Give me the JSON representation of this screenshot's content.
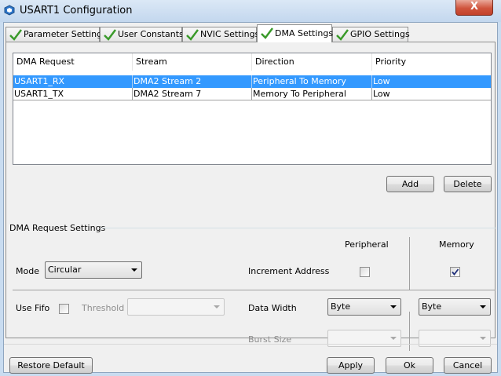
{
  "window": {
    "title": "USART1 Configuration",
    "close_label": "X"
  },
  "tabs": [
    {
      "label": "Parameter Settings",
      "active": false
    },
    {
      "label": "User Constants",
      "active": false
    },
    {
      "label": "NVIC Settings",
      "active": false
    },
    {
      "label": "DMA Settings",
      "active": true
    },
    {
      "label": "GPIO Settings",
      "active": false
    }
  ],
  "dma_table": {
    "columns": [
      "DMA Request",
      "Stream",
      "Direction",
      "Priority"
    ],
    "rows": [
      {
        "request": "USART1_RX",
        "stream": "DMA2 Stream 2",
        "direction": "Peripheral To Memory",
        "priority": "Low",
        "selected": true
      },
      {
        "request": "USART1_TX",
        "stream": "DMA2 Stream 7",
        "direction": "Memory To Peripheral",
        "priority": "Low",
        "selected": false
      }
    ]
  },
  "table_buttons": {
    "add": "Add",
    "delete": "Delete"
  },
  "settings": {
    "group_title": "DMA Request Settings",
    "peripheral_header": "Peripheral",
    "memory_header": "Memory",
    "mode_label": "Mode",
    "mode_value": "Circular",
    "increment_label": "Increment Address",
    "increment_peripheral": false,
    "increment_memory": true,
    "use_fifo_label": "Use Fifo",
    "use_fifo": false,
    "threshold_label": "Threshold",
    "threshold_value": "",
    "data_width_label": "Data Width",
    "data_width_peripheral": "Byte",
    "data_width_memory": "Byte",
    "burst_size_label": "Burst Size",
    "burst_peripheral": "",
    "burst_memory": ""
  },
  "footer": {
    "restore": "Restore Default",
    "apply": "Apply",
    "ok": "Ok",
    "cancel": "Cancel"
  },
  "colors": {
    "selection": "#3399ff",
    "check": "#3a9a2a",
    "close": "#c7482f"
  }
}
